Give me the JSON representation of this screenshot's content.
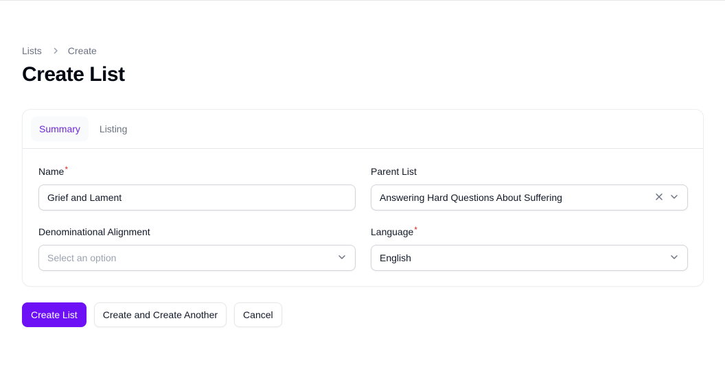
{
  "breadcrumb": {
    "items": [
      "Lists",
      "Create"
    ]
  },
  "page": {
    "title": "Create List"
  },
  "tabs": [
    {
      "label": "Summary",
      "active": true
    },
    {
      "label": "Listing",
      "active": false
    }
  ],
  "form": {
    "name": {
      "label": "Name",
      "required_mark": "*",
      "value": "Grief and Lament"
    },
    "parent_list": {
      "label": "Parent List",
      "value": "Answering Hard Questions About Suffering"
    },
    "denominational_alignment": {
      "label": "Denominational Alignment",
      "placeholder": "Select an option"
    },
    "language": {
      "label": "Language",
      "required_mark": "*",
      "value": "English"
    }
  },
  "actions": {
    "create": "Create List",
    "create_another": "Create and Create Another",
    "cancel": "Cancel"
  },
  "colors": {
    "primary": "#6d10f5",
    "active_tab": "#6d28d9",
    "required": "#dc2626"
  }
}
